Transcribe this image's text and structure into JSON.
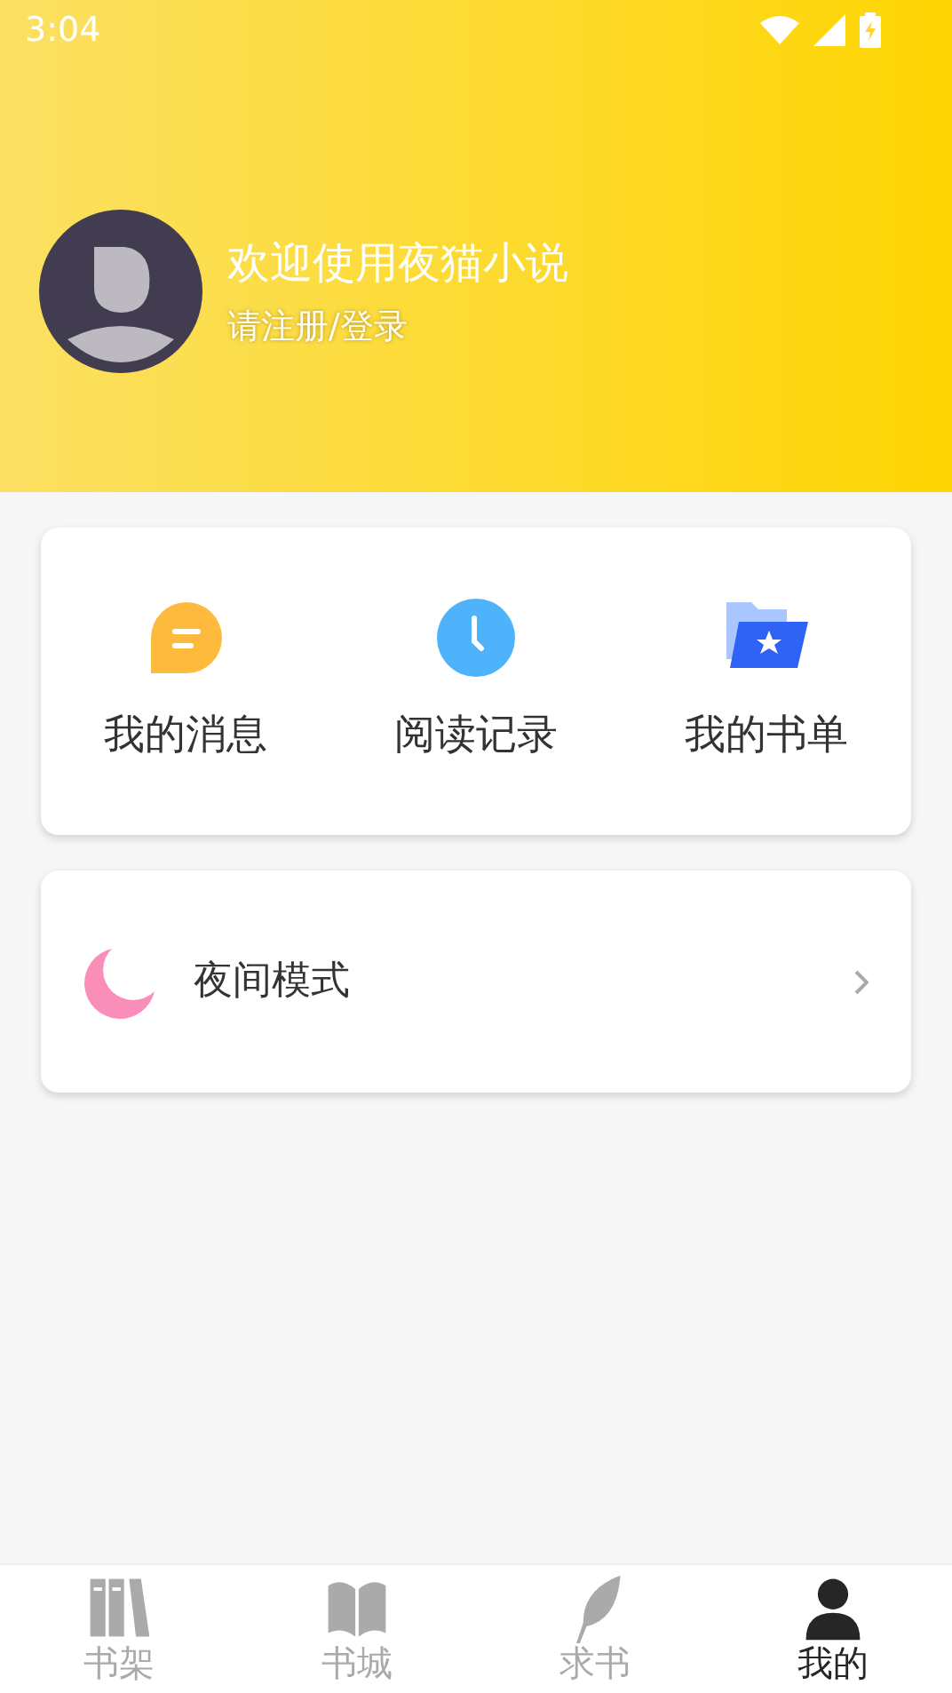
{
  "status_bar": {
    "time": "3:04"
  },
  "profile": {
    "greeting": "欢迎使用夜猫小说",
    "login_link": "请注册/登录"
  },
  "shortcuts": [
    {
      "kind": "message",
      "label": "我的消息"
    },
    {
      "kind": "history",
      "label": "阅读记录"
    },
    {
      "kind": "booklist",
      "label": "我的书单"
    }
  ],
  "settings": [
    {
      "kind": "night",
      "label": "夜间模式"
    }
  ],
  "tabs": [
    {
      "kind": "shelf",
      "label": "书架",
      "selected": false
    },
    {
      "kind": "store",
      "label": "书城",
      "selected": false
    },
    {
      "kind": "request",
      "label": "求书",
      "selected": false
    },
    {
      "kind": "me",
      "label": "我的",
      "selected": true
    }
  ]
}
